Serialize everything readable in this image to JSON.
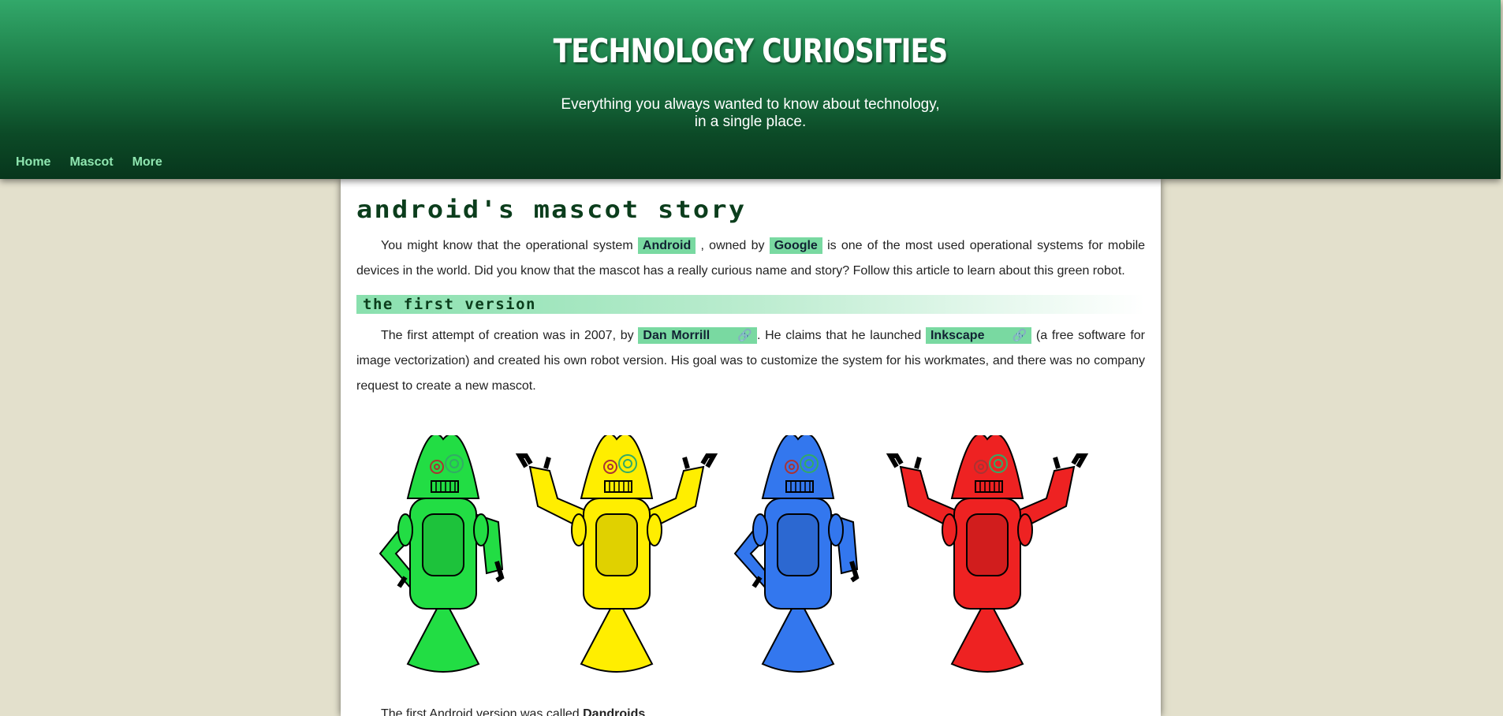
{
  "header": {
    "title": "TECHNOLOGY CURIOSITIES",
    "tagline_line1": "Everything you always wanted to know about technology,",
    "tagline_line2": "in a single place."
  },
  "nav": {
    "items": [
      {
        "label": "Home"
      },
      {
        "label": "Mascot"
      },
      {
        "label": "More"
      }
    ]
  },
  "article": {
    "title": "Android's mascot story",
    "intro": {
      "p1": "You might know that the operational system",
      "android": "Android",
      "p2": ", owned by",
      "google": "Google",
      "p3": "is one of the most used operational systems for mobile devices in the world. Did you know that the mascot has a really curious name and story? Follow this article to learn about this green robot."
    },
    "section1": {
      "title": "The first version",
      "p1": "The first attempt of creation was in 2007, by",
      "dan": "Dan Morrill",
      "p2": ". He claims that he launched",
      "inkscape": "Inkscape",
      "p3": "(a free software for image vectorization) and created his own robot version. His goal was to customize the system for his workmates, and there was no company request to create a new mascot."
    },
    "cut_text_start": "The first Android version was called",
    "cut_text_bold": "Dandroids"
  },
  "robot_colors": [
    "#22dd44",
    "#ffee00",
    "#3377ee",
    "#ee2222"
  ],
  "colors": {
    "accent": "#79d9a1",
    "header_dark": "#07361c",
    "title_dark": "#0b3d1c"
  }
}
